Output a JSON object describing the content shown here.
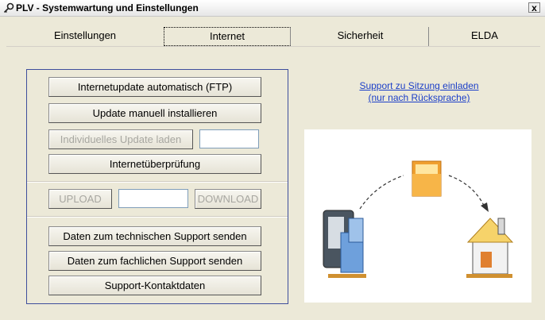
{
  "window": {
    "title": "PLV - Systemwartung und Einstellungen",
    "close": "x"
  },
  "tabs": [
    {
      "label": "Einstellungen"
    },
    {
      "label": "Internet"
    },
    {
      "label": "Sicherheit"
    },
    {
      "label": "ELDA"
    }
  ],
  "buttons": {
    "internet_update": "Internetupdate automatisch (FTP)",
    "manual_update": "Update manuell installieren",
    "individual_update": "Individuelles Update laden",
    "internet_check": "Internetüberprüfung",
    "upload": "UPLOAD",
    "download": "DOWNLOAD",
    "tech_support": "Daten zum technischen Support senden",
    "fach_support": "Daten zum fachlichen Support senden",
    "support_contact": "Support-Kontaktdaten"
  },
  "fields": {
    "individual_update": "",
    "transfer": ""
  },
  "support_link": {
    "line1": "Support zu Sitzung einladen",
    "line2": "(nur nach Rücksprache)"
  },
  "colors": {
    "link": "#1c3fc8",
    "group_border": "#3e4e9c",
    "background": "#ece9d8"
  }
}
